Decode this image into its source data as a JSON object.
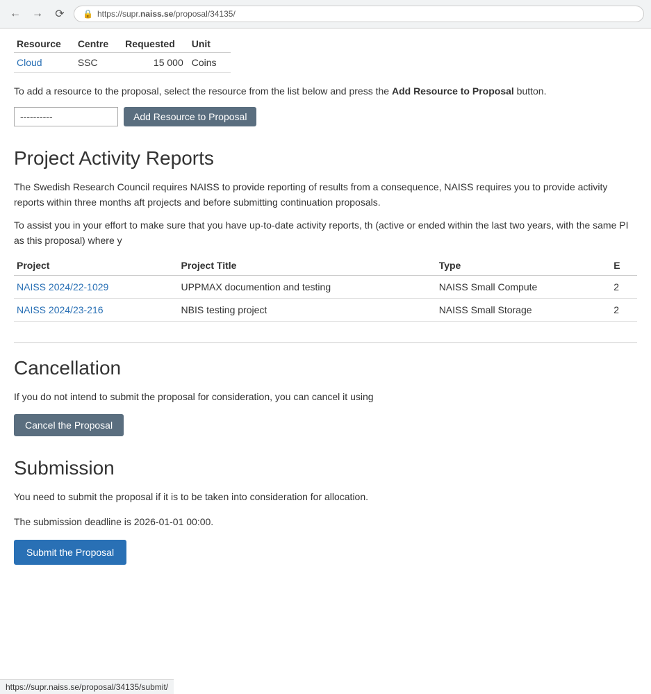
{
  "browser": {
    "url_prefix": "https://supr.",
    "url_domain": "naiss.se",
    "url_path": "/proposal/34135/",
    "url_full": "https://supr.naiss.se/proposal/34135/",
    "status_bar_url": "https://supr.naiss.se/proposal/34135/submit/"
  },
  "resource_table": {
    "headers": [
      "Resource",
      "Centre",
      "Requested",
      "Unit"
    ],
    "rows": [
      {
        "resource": "Cloud",
        "centre": "SSC",
        "requested": "15 000",
        "unit": "Coins"
      }
    ]
  },
  "add_resource": {
    "description_part1": "To add a resource to the proposal, select the resource from the list below and press the ",
    "description_bold": "Add Resource to Proposal",
    "description_part2": " button.",
    "dropdown_value": "----------",
    "button_label": "Add Resource to Proposal"
  },
  "activity_reports": {
    "heading": "Project Activity Reports",
    "paragraph1": "The Swedish Research Council requires NAISS to provide reporting of results from a consequence, NAISS requires you to provide activity reports within three months aft projects and before submitting continuation proposals.",
    "paragraph2": "To assist you in your effort to make sure that you have up-to-date activity reports, th (active or ended within the last two years, with the same PI as this proposal) where y",
    "table": {
      "headers": [
        "Project",
        "Project Title",
        "Type",
        "E"
      ],
      "rows": [
        {
          "project": "NAISS 2024/22-1029",
          "title": "UPPMAX documention and testing",
          "type": "NAISS Small Compute",
          "extra": "2"
        },
        {
          "project": "NAISS 2024/23-216",
          "title": "NBIS testing project",
          "type": "NAISS Small Storage",
          "extra": "2"
        }
      ]
    }
  },
  "cancellation": {
    "heading": "Cancellation",
    "text": "If you do not intend to submit the proposal for consideration, you can cancel it using",
    "button_label": "Cancel the Proposal"
  },
  "submission": {
    "heading": "Submission",
    "text1": "You need to submit the proposal if it is to be taken into consideration for allocation.",
    "text2": "The submission deadline is 2026-01-01 00:00.",
    "button_label": "Submit the Proposal"
  }
}
